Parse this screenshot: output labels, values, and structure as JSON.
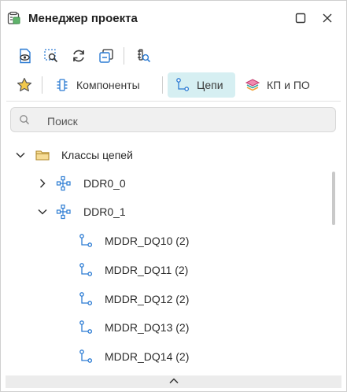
{
  "window": {
    "title": "Менеджер проекта"
  },
  "tabs": [
    {
      "label": "Компоненты"
    },
    {
      "label": "Цепи"
    },
    {
      "label": "КП и ПО"
    }
  ],
  "search": {
    "placeholder": "Поиск",
    "value": ""
  },
  "tree": {
    "root": {
      "label": "Классы цепей",
      "expanded": true
    },
    "groups": [
      {
        "label": "DDR0_0",
        "expanded": false
      },
      {
        "label": "DDR0_1",
        "expanded": true
      }
    ],
    "nets": [
      {
        "label": "MDDR_DQ10 (2)"
      },
      {
        "label": "MDDR_DQ11 (2)"
      },
      {
        "label": "MDDR_DQ12 (2)"
      },
      {
        "label": "MDDR_DQ13 (2)"
      },
      {
        "label": "MDDR_DQ14 (2)"
      }
    ]
  },
  "colors": {
    "accent": "#2b7bd3",
    "active_tab_bg": "#d6eff2",
    "star": "#f2c94c",
    "folder": "#e8c46a"
  },
  "icons": {
    "title": "project-manager-icon",
    "toolbar": [
      "document-view-icon",
      "select-zoom-icon",
      "refresh-icon",
      "collapse-icon",
      "search-list-icon"
    ],
    "favorite": "star-icon",
    "components_tab": "component-icon",
    "nets_tab": "net-icon",
    "layers_tab": "layers-icon"
  }
}
